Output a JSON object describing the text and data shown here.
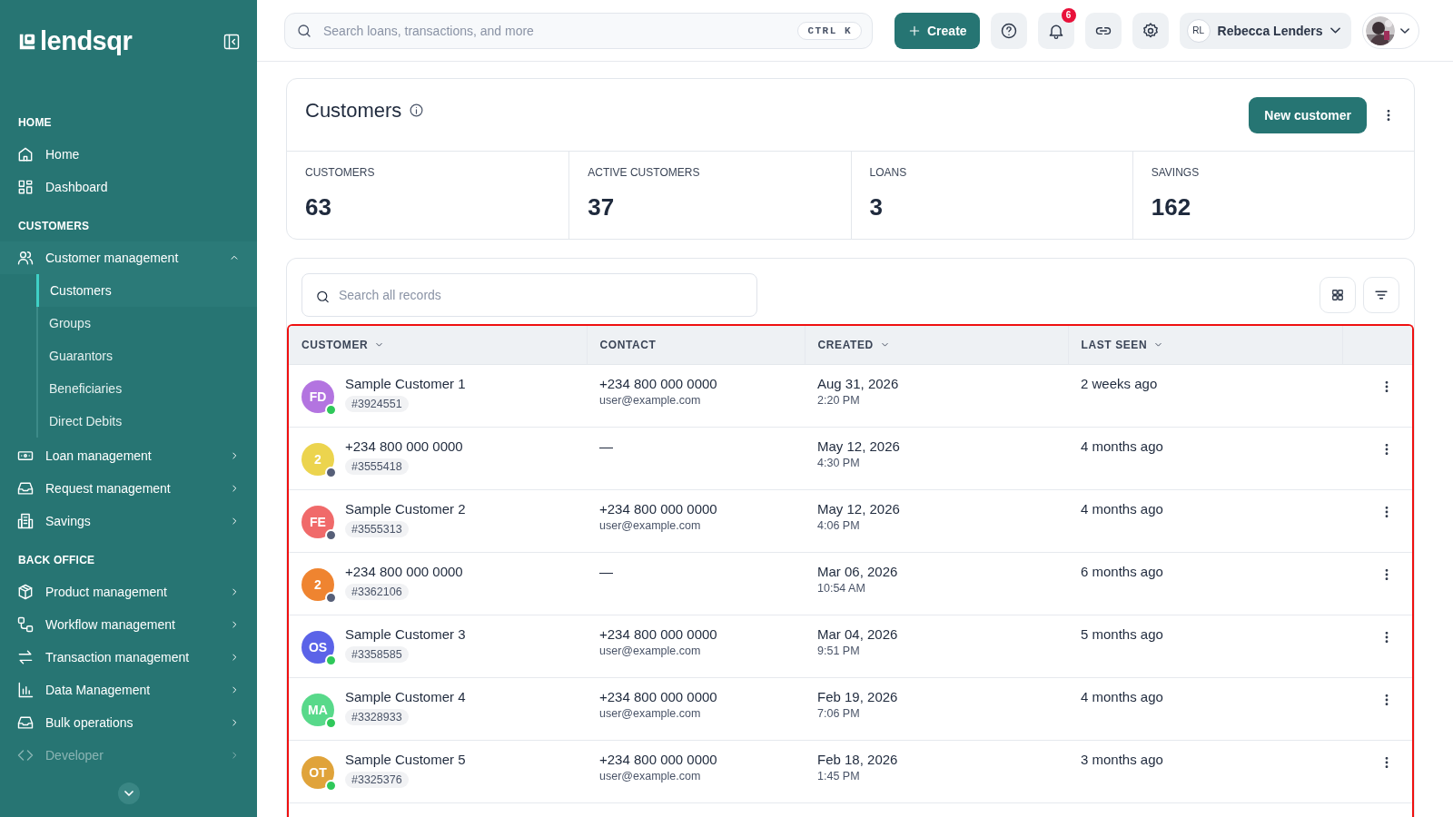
{
  "sidebar": {
    "logo": "lendsqr",
    "sections": [
      {
        "heading": "HOME",
        "items": [
          {
            "label": "Home",
            "kind": "link",
            "disabled": false
          },
          {
            "label": "Dashboard",
            "kind": "link",
            "disabled": false
          }
        ]
      },
      {
        "heading": "CUSTOMERS",
        "items": [
          {
            "label": "Customer management",
            "kind": "group",
            "expanded": true,
            "disabled": false,
            "children": [
              {
                "label": "Customers",
                "selected": true
              },
              {
                "label": "Groups",
                "selected": false
              },
              {
                "label": "Guarantors",
                "selected": false
              },
              {
                "label": "Beneficiaries",
                "selected": false
              },
              {
                "label": "Direct Debits",
                "selected": false
              }
            ]
          },
          {
            "label": "Loan management",
            "kind": "group",
            "expanded": false,
            "disabled": false
          },
          {
            "label": "Request management",
            "kind": "group",
            "expanded": false,
            "disabled": false
          },
          {
            "label": "Savings",
            "kind": "group",
            "expanded": false,
            "disabled": false
          }
        ]
      },
      {
        "heading": "BACK OFFICE",
        "items": [
          {
            "label": "Product management",
            "kind": "group",
            "expanded": false,
            "disabled": false
          },
          {
            "label": "Workflow management",
            "kind": "group",
            "expanded": false,
            "disabled": false
          },
          {
            "label": "Transaction management",
            "kind": "group",
            "expanded": false,
            "disabled": false
          },
          {
            "label": "Data Management",
            "kind": "group",
            "expanded": false,
            "disabled": false
          },
          {
            "label": "Bulk operations",
            "kind": "group",
            "expanded": false,
            "disabled": false
          },
          {
            "label": "Developer",
            "kind": "group",
            "expanded": false,
            "disabled": true
          }
        ]
      }
    ]
  },
  "topbar": {
    "search": {
      "placeholder": "Search loans, transactions, and more",
      "shortcut": "CTRL K"
    },
    "create_button": "Create",
    "notification_count": "6",
    "user": {
      "initials": "RL",
      "name": "Rebecca Lenders"
    }
  },
  "page": {
    "title": "Customers",
    "new_button": "New customer",
    "stats": [
      {
        "label": "CUSTOMERS",
        "value": "63"
      },
      {
        "label": "ACTIVE CUSTOMERS",
        "value": "37"
      },
      {
        "label": "LOANS",
        "value": "3"
      },
      {
        "label": "SAVINGS",
        "value": "162"
      }
    ]
  },
  "table": {
    "search": {
      "placeholder": "Search all records"
    },
    "columns": [
      {
        "label": "CUSTOMER",
        "sortable": true
      },
      {
        "label": "CONTACT",
        "sortable": false
      },
      {
        "label": "CREATED",
        "sortable": true
      },
      {
        "label": "LAST SEEN",
        "sortable": true
      }
    ],
    "rows": [
      {
        "initials": "FD",
        "color": "#b374e0",
        "online": true,
        "name": "Sample Customer 1",
        "id": "#3924551",
        "phone": "+234 800 000 0000",
        "email": "user@example.com",
        "date": "Aug 31, 2026",
        "time": "2:20 PM",
        "last_seen": "2 weeks ago"
      },
      {
        "initials": "2",
        "color": "#ecd44e",
        "online": false,
        "name": "+234 800 000 0000",
        "id": "#3555418",
        "phone": "—",
        "date": "May 12, 2026",
        "time": "4:30 PM",
        "last_seen": "4 months ago"
      },
      {
        "initials": "FE",
        "color": "#f06a6a",
        "online": false,
        "name": "Sample Customer 2",
        "id": "#3555313",
        "phone": "+234 800 000 0000",
        "email": "user@example.com",
        "date": "May 12, 2026",
        "time": "4:06 PM",
        "last_seen": "4 months ago"
      },
      {
        "initials": "2",
        "color": "#ef8430",
        "online": false,
        "name": "+234 800 000 0000",
        "id": "#3362106",
        "phone": "—",
        "date": "Mar 06, 2026",
        "time": "10:54 AM",
        "last_seen": "6 months ago"
      },
      {
        "initials": "OS",
        "color": "#5b63e8",
        "online": true,
        "name": "Sample Customer 3",
        "id": "#3358585",
        "phone": "+234 800 000 0000",
        "email": "user@example.com",
        "date": "Mar 04, 2026",
        "time": "9:51 PM",
        "last_seen": "5 months ago"
      },
      {
        "initials": "MA",
        "color": "#58d98a",
        "online": true,
        "name": "Sample Customer 4",
        "id": "#3328933",
        "phone": "+234 800 000 0000",
        "email": "user@example.com",
        "date": "Feb 19, 2026",
        "time": "7:06 PM",
        "last_seen": "4 months ago"
      },
      {
        "initials": "OT",
        "color": "#e0a33a",
        "online": true,
        "name": "Sample Customer 5",
        "id": "#3325376",
        "phone": "+234 800 000 0000",
        "email": "user@example.com",
        "date": "Feb 18, 2026",
        "time": "1:45 PM",
        "last_seen": "3 months ago"
      }
    ]
  }
}
